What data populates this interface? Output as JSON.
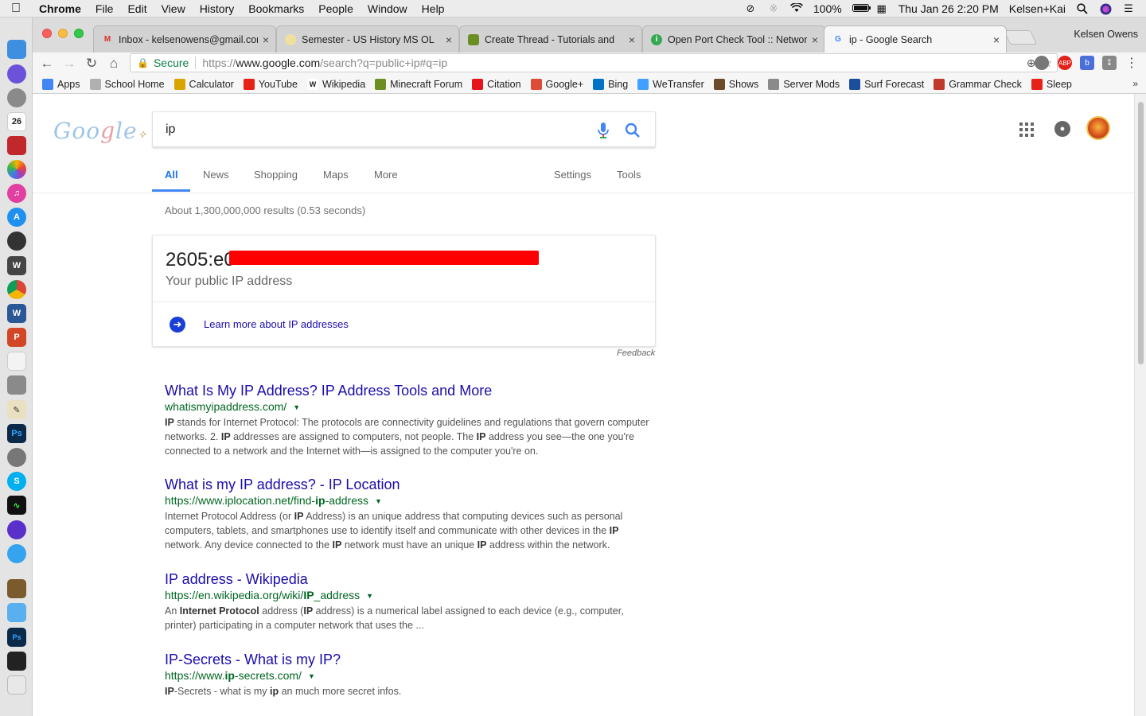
{
  "menubar": {
    "app": "Chrome",
    "menus": [
      "File",
      "Edit",
      "View",
      "History",
      "Bookmarks",
      "People",
      "Window",
      "Help"
    ],
    "battery": "100%",
    "datetime": "Thu Jan 26  2:20 PM",
    "user": "Kelsen+Kai"
  },
  "browser": {
    "tabs": [
      {
        "title": "Inbox - kelsenowens@gmail.com",
        "favicon": "gmail-icon"
      },
      {
        "title": "Semester - US History MS OL",
        "favicon": "globe-icon"
      },
      {
        "title": "Create Thread - Tutorials and",
        "favicon": "cube-icon"
      },
      {
        "title": "Open Port Check Tool :: Network",
        "favicon": "ip-icon"
      },
      {
        "title": "ip - Google Search",
        "favicon": "google-icon"
      }
    ],
    "profile": "Kelsen Owens",
    "secure_label": "Secure",
    "url_scheme": "https://",
    "url_host": "www.google.com",
    "url_path": "/search?q=public+ip#q=ip",
    "bookmarks": [
      {
        "label": "Apps",
        "icon": "apps-grid-icon",
        "color": "#4285f4"
      },
      {
        "label": "School Home",
        "icon": "globe-icon",
        "color": "#b0b0b0"
      },
      {
        "label": "Calculator",
        "icon": "calculator-icon",
        "color": "#d9a400"
      },
      {
        "label": "YouTube",
        "icon": "youtube-icon",
        "color": "#e62117"
      },
      {
        "label": "Wikipedia",
        "icon": "wikipedia-icon",
        "color": "#ffffff"
      },
      {
        "label": "Minecraft Forum",
        "icon": "minecraft-icon",
        "color": "#6b8e23"
      },
      {
        "label": "Citation",
        "icon": "citation-icon",
        "color": "#e8141c"
      },
      {
        "label": "Google+",
        "icon": "googleplus-icon",
        "color": "#dd4b39"
      },
      {
        "label": "Bing",
        "icon": "bing-icon",
        "color": "#0073c6"
      },
      {
        "label": "WeTransfer",
        "icon": "wetransfer-icon",
        "color": "#409fff"
      },
      {
        "label": "Shows",
        "icon": "film-icon",
        "color": "#6b4a2a"
      },
      {
        "label": "Server Mods",
        "icon": "folder-icon",
        "color": "#8a8a8a"
      },
      {
        "label": "Surf Forecast",
        "icon": "wave-icon",
        "color": "#1b4f9c"
      },
      {
        "label": "Grammar Check",
        "icon": "grammar-icon",
        "color": "#c0392b"
      },
      {
        "label": "Sleep",
        "icon": "sleep-icon",
        "color": "#e62117"
      }
    ]
  },
  "google": {
    "query": "ip",
    "tabs": [
      "All",
      "News",
      "Shopping",
      "Maps",
      "More",
      "Settings",
      "Tools"
    ],
    "stats": "About 1,300,000,000 results (0.53 seconds)",
    "ip_card": {
      "ip_visible": "2605:e0",
      "label": "Your public IP address",
      "learn_more": "Learn more about IP addresses",
      "feedback": "Feedback"
    },
    "results": [
      {
        "title": "What Is My IP Address? IP Address Tools and More",
        "url": "whatismyipaddress.com/",
        "snippet_html": "<b>IP</b> stands for Internet Protocol: The protocols are connectivity guidelines and regulations that govern computer networks. 2. <b>IP</b> addresses are assigned to computers, not people. The <b>IP</b> address you see—the one you're connected to a network and the Internet with—is assigned to the computer you're on."
      },
      {
        "title": "What is my IP address? - IP Location",
        "url": "https://www.iplocation.net/find-<b>ip</b>-address",
        "snippet_html": "Internet Protocol Address (or <b>IP</b> Address) is an unique address that computing devices such as personal computers, tablets, and smartphones use to identify itself and communicate with other devices in the <b>IP</b> network. Any device connected to the <b>IP</b> network must have an unique <b>IP</b> address within the network."
      },
      {
        "title": "IP address - Wikipedia",
        "url": "https://en.wikipedia.org/wiki/<b>IP</b>_address",
        "snippet_html": "An <b>Internet Protocol</b> address (<b>IP</b> address) is a numerical label assigned to each device (e.g., computer, printer) participating in a computer network that uses the ..."
      },
      {
        "title": "IP-Secrets - What is my IP?",
        "url": "https://www.<b>ip</b>-secrets.com/",
        "snippet_html": "<b>IP</b>-Secrets - what is my <b>ip</b> an much more secret infos."
      }
    ]
  }
}
